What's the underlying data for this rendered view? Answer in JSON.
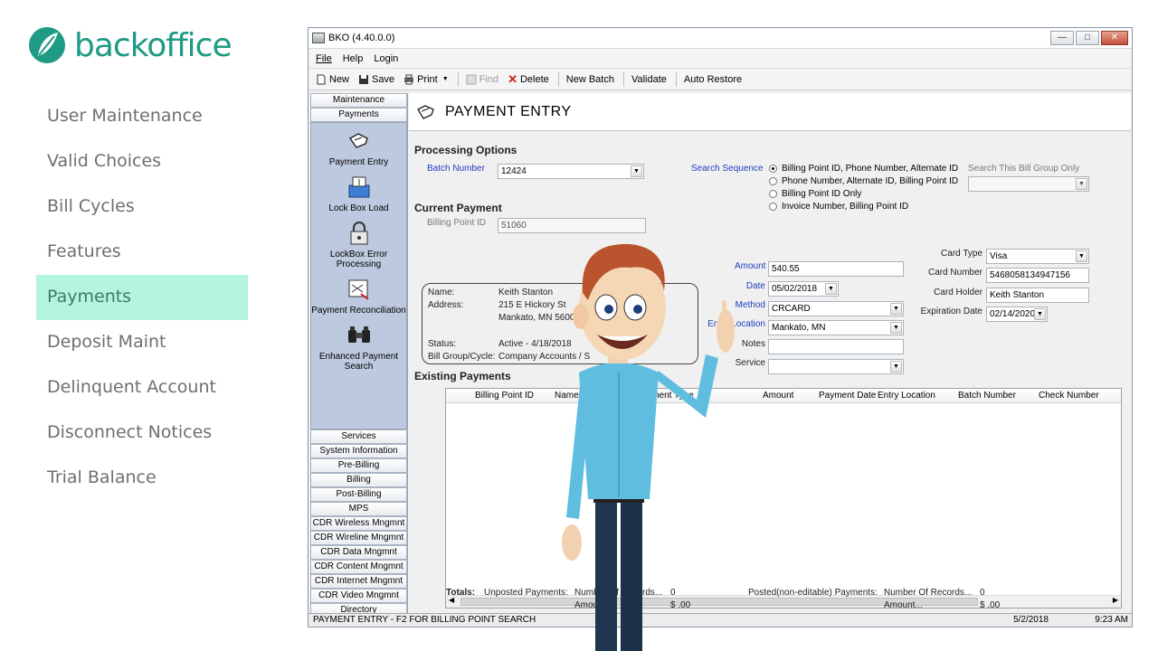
{
  "brand": {
    "name": "backoffice",
    "color": "#1f9a84"
  },
  "left_nav": {
    "items": [
      "User Maintenance",
      "Valid Choices",
      "Bill Cycles",
      "Features",
      "Payments",
      "Deposit Maint",
      "Delinquent Account",
      "Disconnect Notices",
      "Trial Balance"
    ],
    "active": "Payments"
  },
  "window": {
    "title": "BKO (4.40.0.0)"
  },
  "menu": {
    "file": "File",
    "help": "Help",
    "login": "Login"
  },
  "toolbar": {
    "new": "New",
    "save": "Save",
    "print": "Print",
    "find": "Find",
    "delete": "Delete",
    "new_batch": "New Batch",
    "validate": "Validate",
    "auto_restore": "Auto Restore"
  },
  "app_nav": {
    "maintenance": "Maintenance",
    "payments": "Payments",
    "panel_items": [
      "Payment Entry",
      "Lock Box Load",
      "LockBox Error Processing",
      "Payment Reconciliation",
      "Enhanced Payment Search"
    ],
    "sections": [
      "Services",
      "System Information",
      "Pre-Billing",
      "Billing",
      "Post-Billing",
      "MPS",
      "CDR Wireless Mngmnt",
      "CDR Wireline Mngmnt",
      "CDR Data Mngmnt",
      "CDR Content Mngmnt",
      "CDR Internet Mngmnt",
      "CDR Video Mngmnt",
      "Directory"
    ]
  },
  "page": {
    "title": "PAYMENT ENTRY",
    "processing_options": "Processing Options",
    "batch_number_label": "Batch Number",
    "batch_number": "12424",
    "search_sequence_label": "Search Sequence",
    "search_sequence_options": [
      "Billing Point ID, Phone Number, Alternate ID",
      "Phone Number, Alternate ID, Billing Point ID",
      "Billing Point ID Only",
      "Invoice Number, Billing Point ID"
    ],
    "search_bill_group_label": "Search This Bill Group Only",
    "current_payment": "Current Payment",
    "billing_point_id_label": "Billing Point ID",
    "billing_point_id": "51060",
    "customer": {
      "name_label": "Name:",
      "name": "Keith Stanton",
      "address_label": "Address:",
      "address1": "215 E Hickory St",
      "address2": "Mankato, MN 56001-0",
      "status_label": "Status:",
      "status": "Active - 4/18/2018",
      "bill_group_label": "Bill Group/Cycle:",
      "bill_group": "Company Accounts / S"
    },
    "amount_label": "Amount",
    "amount": "540.55",
    "date_label": "Date",
    "date": "05/02/2018",
    "method_label": "Method",
    "method": "CRCARD",
    "entry_location_label": "Entry Location",
    "entry_location": "Mankato, MN",
    "notes_label": "Notes",
    "service_label": "Service",
    "card_type_label": "Card Type",
    "card_type": "Visa",
    "card_number_label": "Card Number",
    "card_number": "5468058134947156",
    "card_holder_label": "Card Holder",
    "card_holder": "Keith Stanton",
    "expiration_label": "Expiration Date",
    "expiration": "02/14/2020",
    "existing_payments": "Existing Payments",
    "grid_columns": [
      "Billing Point ID",
      "Name",
      "Payment Type",
      "Amount",
      "Payment Date",
      "Entry Location",
      "Batch Number",
      "Check Number"
    ],
    "totals": {
      "label": "Totals:",
      "unposted": "Unposted Payments:",
      "num_records_label": "Number Of Records...",
      "unposted_records": "0",
      "amount_label": "Amount...",
      "unposted_amount": "$ .00",
      "posted": "Posted(non-editable) Payments:",
      "posted_records": "0",
      "posted_amount": "$ .00"
    }
  },
  "status": {
    "message": "PAYMENT ENTRY - F2 FOR BILLING POINT SEARCH",
    "date": "5/2/2018",
    "time": "9:23 AM"
  }
}
